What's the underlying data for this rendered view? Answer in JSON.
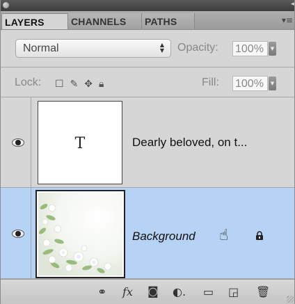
{
  "tabs": [
    {
      "label": "LAYERS",
      "active": true
    },
    {
      "label": "CHANNELS",
      "active": false
    },
    {
      "label": "PATHS",
      "active": false
    }
  ],
  "icons": {
    "panel_menu": "panel-menu-icon",
    "collapse": "collapse-arrows-icon",
    "close": "close-dot-icon"
  },
  "controls": {
    "blend_mode": "Normal",
    "opacity_label": "Opacity:",
    "opacity_value": "100%",
    "lock_label": "Lock:",
    "fill_label": "Fill:",
    "fill_value": "100%"
  },
  "layers": [
    {
      "name": "Dearly beloved, on t...",
      "kind": "text",
      "thumb_glyph": "T",
      "visible": true,
      "selected": false
    },
    {
      "name": "Background",
      "kind": "image",
      "visible": true,
      "selected": true,
      "locked": true
    }
  ],
  "bottom_icons": [
    "link-layers-icon",
    "fx-icon",
    "add-mask-icon",
    "adjustment-layer-icon",
    "new-group-icon",
    "new-layer-icon",
    "trash-icon"
  ],
  "fx_label": "fx",
  "colors": {
    "selected_row": "#b6d2f5",
    "panel_bg": "#d6d6d6"
  }
}
